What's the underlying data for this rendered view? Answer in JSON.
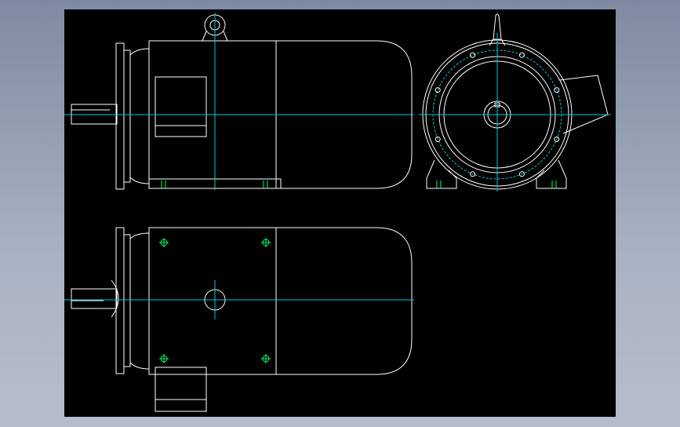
{
  "canvas": {
    "background": "#000000",
    "frame_background": "#a9b2c2"
  },
  "colors": {
    "outline": "#ffffff",
    "centerline": "#00c8d8",
    "bolt_marks": "#00ff66"
  },
  "views": [
    {
      "id": "side-view",
      "kind": "motor side elevation with lifting eye and terminal box"
    },
    {
      "id": "end-view",
      "kind": "motor flange end view with bolt circle and feet"
    },
    {
      "id": "top-view",
      "kind": "motor plan view with mounting holes and terminal box"
    }
  ],
  "end_view": {
    "bolt_count": 8
  },
  "top_view": {
    "mounting_hole_count": 4
  }
}
